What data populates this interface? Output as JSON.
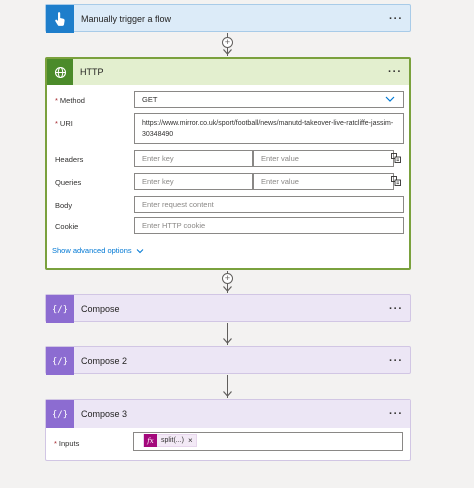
{
  "trigger": {
    "title": "Manually trigger a flow",
    "icon": "hand-touch-icon",
    "more": "···"
  },
  "http": {
    "title": "HTTP",
    "icon": "globe-icon",
    "more": "···",
    "method": {
      "label": "Method",
      "value": "GET"
    },
    "uri": {
      "label": "URI",
      "value": "https://www.mirror.co.uk/sport/football/news/manutd-takeover-live-ratcliffe-jassim-30348490"
    },
    "headers": {
      "label": "Headers",
      "key_placeholder": "Enter key",
      "value_placeholder": "Enter value"
    },
    "queries": {
      "label": "Queries",
      "key_placeholder": "Enter key",
      "value_placeholder": "Enter value"
    },
    "body": {
      "label": "Body",
      "placeholder": "Enter request content"
    },
    "cookie": {
      "label": "Cookie",
      "placeholder": "Enter HTTP cookie"
    },
    "advanced_label": "Show advanced options"
  },
  "compose1": {
    "title": "Compose",
    "more": "···"
  },
  "compose2": {
    "title": "Compose 2",
    "more": "···"
  },
  "compose3": {
    "title": "Compose 3",
    "more": "···",
    "inputs_label": "Inputs",
    "token_fx": "fx",
    "token_text": "split(...)",
    "token_remove": "×"
  },
  "colors": {
    "trigger_accent": "#1e7ecb",
    "http_accent": "#4b8b2a",
    "compose_accent": "#8c6cd1",
    "expression_token": "#a4087c",
    "link": "#0078d4"
  }
}
